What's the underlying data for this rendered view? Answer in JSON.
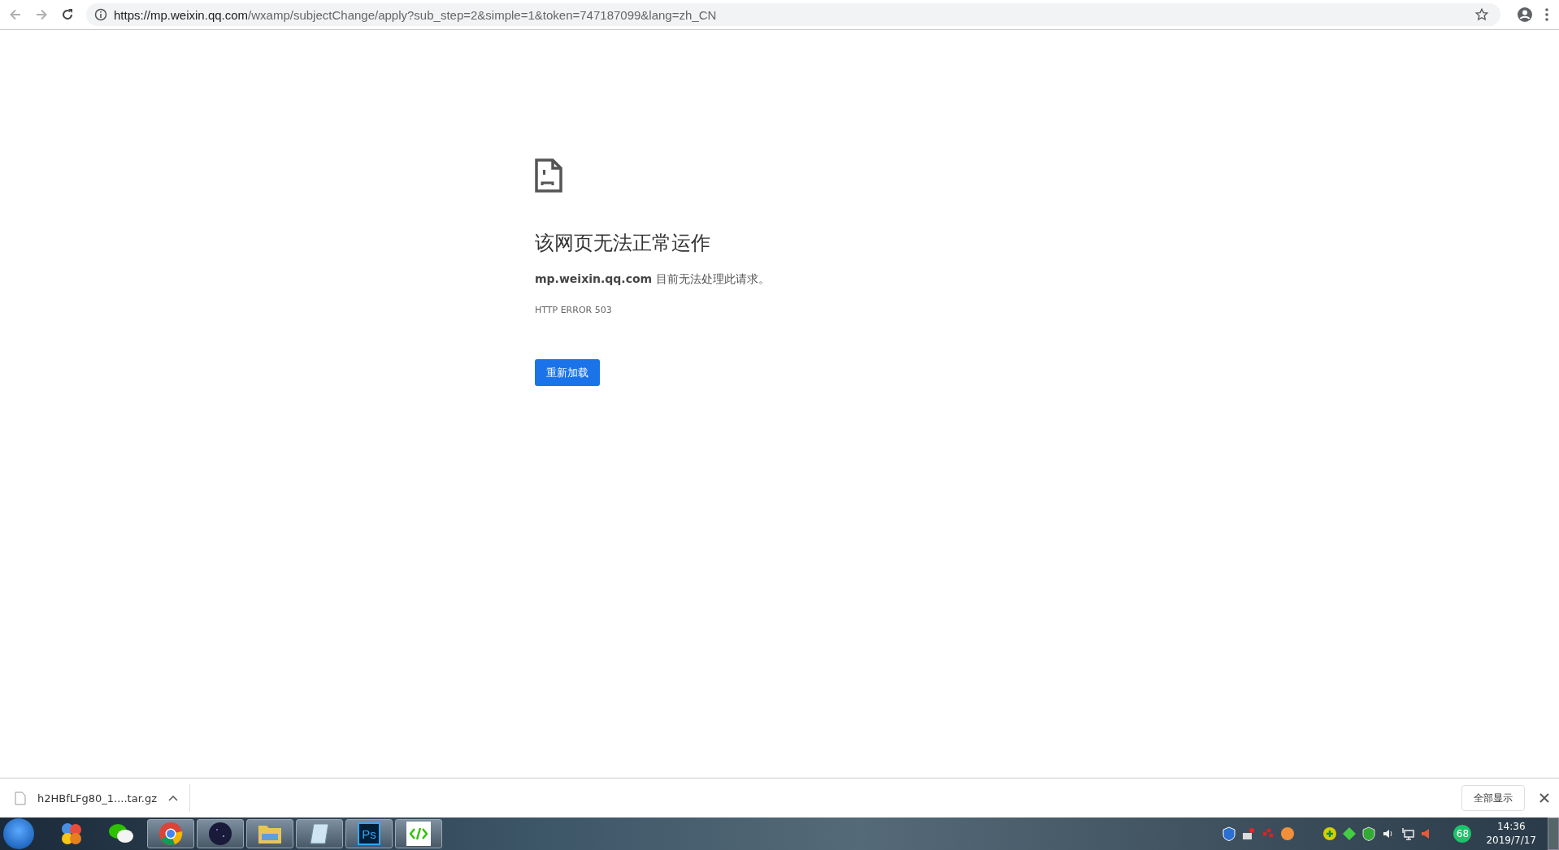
{
  "address_bar": {
    "url_host": "https://mp.weixin.qq.com",
    "url_rest": "/wxamp/subjectChange/apply?sub_step=2&simple=1&token=747187099&lang=zh_CN"
  },
  "error_page": {
    "title": "该网页无法正常运作",
    "message": "**mp.weixin.qq.com** 目前无法处理此请求。",
    "code": "HTTP ERROR 503",
    "button": "重新加载"
  },
  "download_bar": {
    "file": "h2HBfLFg80_1....tar.gz",
    "show_all": "全部显示"
  },
  "taskbar": {
    "apps": [
      {
        "kind": "colorful",
        "active": false
      },
      {
        "kind": "chat",
        "active": false
      },
      {
        "kind": "browser",
        "active": true
      },
      {
        "kind": "orb",
        "active": true
      },
      {
        "kind": "folder",
        "active": true
      },
      {
        "kind": "notepad",
        "active": true
      },
      {
        "kind": "ps",
        "label": "Ps",
        "active": true
      },
      {
        "kind": "code",
        "active": true
      }
    ],
    "tray_badge": "68",
    "time": "14:36",
    "date": "2019/7/17"
  }
}
